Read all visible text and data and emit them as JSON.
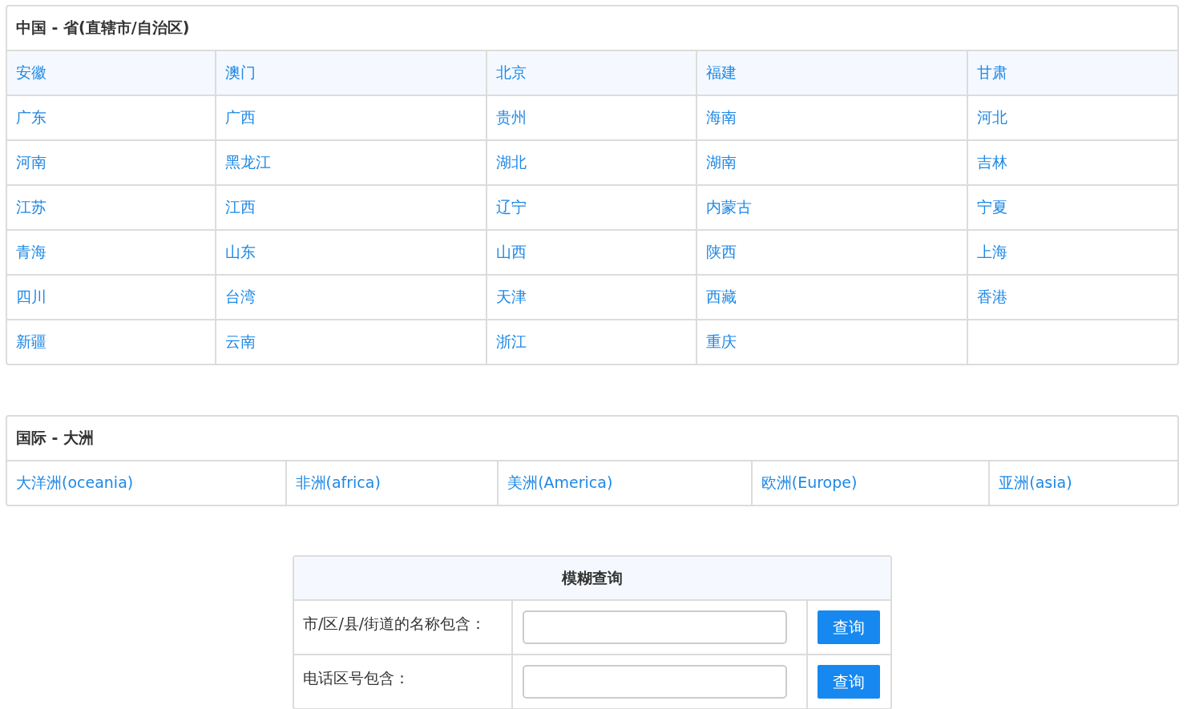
{
  "china": {
    "title": "中国 - 省(直辖市/自治区)",
    "items": [
      "安徽",
      "澳门",
      "北京",
      "福建",
      "甘肃",
      "广东",
      "广西",
      "贵州",
      "海南",
      "河北",
      "河南",
      "黑龙江",
      "湖北",
      "湖南",
      "吉林",
      "江苏",
      "江西",
      "辽宁",
      "内蒙古",
      "宁夏",
      "青海",
      "山东",
      "山西",
      "陕西",
      "上海",
      "四川",
      "台湾",
      "天津",
      "西藏",
      "香港",
      "新疆",
      "云南",
      "浙江",
      "重庆"
    ]
  },
  "world": {
    "title": "国际 - 大洲",
    "items": [
      "大洋洲(oceania)",
      "非洲(africa)",
      "美洲(America)",
      "欧洲(Europe)",
      "亚洲(asia)"
    ]
  },
  "search": {
    "title": "模糊查询",
    "rows": [
      {
        "label": "市/区/县/街道的名称包含：",
        "button": "查询"
      },
      {
        "label": "电话区号包含：",
        "button": "查询"
      }
    ]
  }
}
